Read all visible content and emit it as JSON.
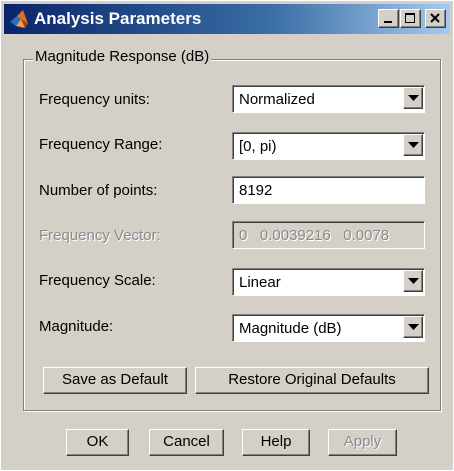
{
  "window": {
    "title": "Analysis Parameters",
    "title_icon": "matlab-logo-icon",
    "controls": [
      "minimize-icon",
      "maximize-icon",
      "close-icon"
    ]
  },
  "group": {
    "legend": "Magnitude Response (dB)"
  },
  "fields": {
    "frequency_units": {
      "label": "Frequency units:",
      "value": "Normalized"
    },
    "frequency_range": {
      "label": "Frequency Range:",
      "value": "[0, pi)"
    },
    "number_of_points": {
      "label": "Number of points:",
      "value": "8192"
    },
    "frequency_vector": {
      "label": "Frequency Vector:",
      "value": "0   0.0039216   0.0078"
    },
    "frequency_scale": {
      "label": "Frequency Scale:",
      "value": "Linear"
    },
    "magnitude": {
      "label": "Magnitude:",
      "value": "Magnitude (dB)"
    }
  },
  "buttons": {
    "save_default": "Save as Default",
    "restore_defaults": "Restore Original Defaults",
    "ok": "OK",
    "cancel": "Cancel",
    "help": "Help",
    "apply": "Apply"
  },
  "colors": {
    "face": "#d4d0c8",
    "title_start": "#0a246a",
    "title_end": "#a6caf0",
    "disabled_text": "#8a8a8a"
  }
}
